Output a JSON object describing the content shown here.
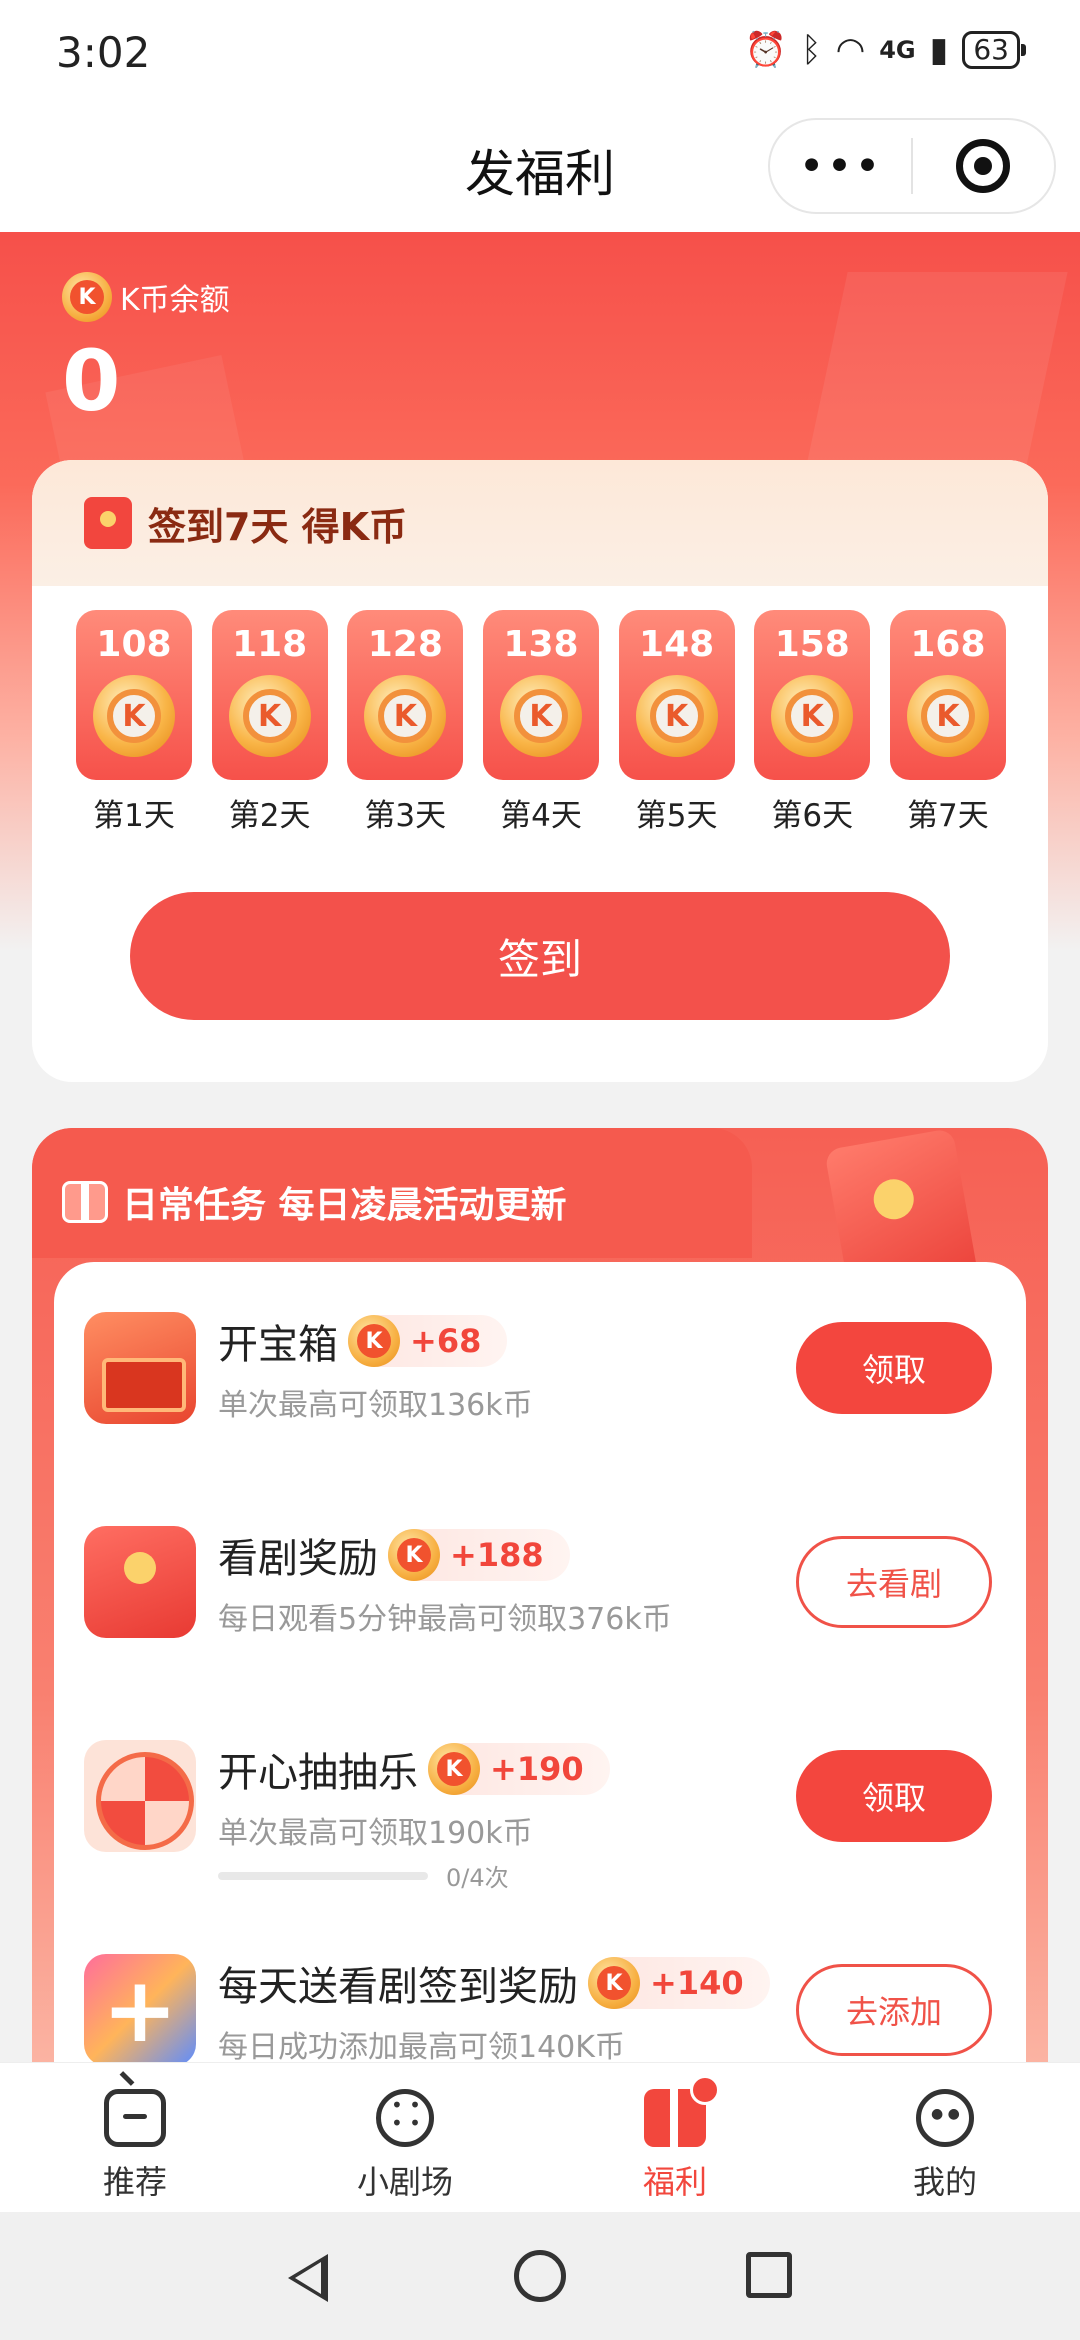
{
  "status_bar": {
    "time": "3:02",
    "battery": "63",
    "network": "4G"
  },
  "header": {
    "title": "发福利",
    "more": "•••"
  },
  "balance": {
    "label": "K币余额",
    "value": "0"
  },
  "coin_mark": "K",
  "signin": {
    "title": "签到7天 得K币",
    "days": [
      {
        "amount": "108",
        "label": "第1天"
      },
      {
        "amount": "118",
        "label": "第2天"
      },
      {
        "amount": "128",
        "label": "第3天"
      },
      {
        "amount": "138",
        "label": "第4天"
      },
      {
        "amount": "148",
        "label": "第5天"
      },
      {
        "amount": "158",
        "label": "第6天"
      },
      {
        "amount": "168",
        "label": "第7天"
      }
    ],
    "button": "签到"
  },
  "daily_tasks": {
    "title": "日常任务 每日凌晨活动更新",
    "items": [
      {
        "name": "开宝箱",
        "reward": "+68",
        "desc": "单次最高可领取136k币",
        "button": "领取",
        "icon": "treasure-box-icon"
      },
      {
        "name": "看剧奖励",
        "reward": "+188",
        "desc": "每日观看5分钟最高可领取376k币",
        "button": "去看剧",
        "icon": "red-packet-icon"
      },
      {
        "name": "开心抽抽乐",
        "reward": "+190",
        "desc": "单次最高可领取190k币",
        "button": "领取",
        "progress_text": "0/4次",
        "progress": 0,
        "icon": "lucky-wheel-icon"
      },
      {
        "name": "每天送看剧签到奖励",
        "reward": "+140",
        "desc": "每日成功添加最高可领140K币",
        "button": "去添加",
        "icon": "add-shortcut-icon"
      }
    ]
  },
  "bottom_nav": [
    {
      "label": "推荐",
      "icon": "tv-icon"
    },
    {
      "label": "小剧场",
      "icon": "film-reel-icon"
    },
    {
      "label": "福利",
      "icon": "gift-icon",
      "active": true
    },
    {
      "label": "我的",
      "icon": "profile-face-icon"
    }
  ],
  "colors": {
    "accent": "#f3463e",
    "hero_top": "#f6504a",
    "text_dark": "#222222",
    "text_muted": "#999999"
  }
}
